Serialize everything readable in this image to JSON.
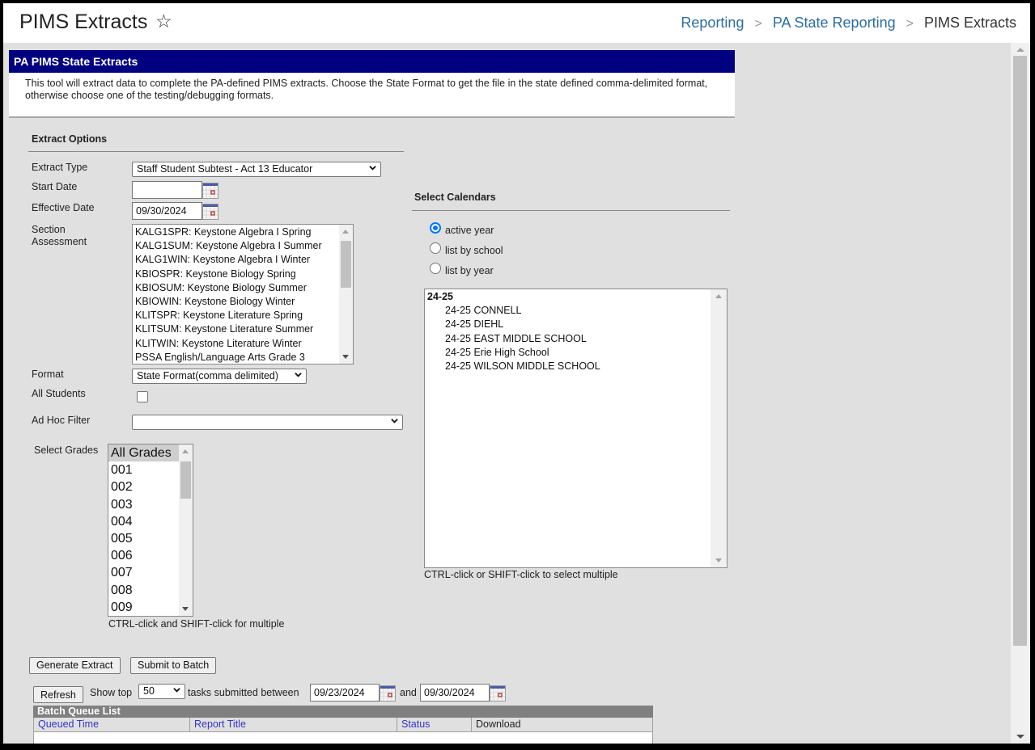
{
  "header": {
    "title": "PIMS Extracts",
    "breadcrumb": [
      "Reporting",
      "PA State Reporting",
      "PIMS Extracts"
    ]
  },
  "panel": {
    "title": "PA PIMS State Extracts",
    "description": "This tool will extract data to complete the PA-defined PIMS extracts. Choose the State Format to get the file in the state defined comma-delimited format, otherwise choose one of the testing/debugging formats."
  },
  "extract_options": {
    "section_title": "Extract Options",
    "extract_type": {
      "label": "Extract Type",
      "value": "Staff Student Subtest - Act 13 Educator"
    },
    "start_date": {
      "label": "Start Date",
      "value": ""
    },
    "effective_date": {
      "label": "Effective Date",
      "value": "09/30/2024"
    },
    "section_assessment": {
      "label_line1": "Section",
      "label_line2": "Assessment",
      "options": [
        "KALG1SPR: Keystone Algebra I Spring",
        "KALG1SUM: Keystone Algebra I Summer",
        "KALG1WIN: Keystone Algebra I Winter",
        "KBIOSPR: Keystone Biology Spring",
        "KBIOSUM: Keystone Biology Summer",
        "KBIOWIN: Keystone Biology Winter",
        "KLITSPR: Keystone Literature Spring",
        "KLITSUM: Keystone Literature Summer",
        "KLITWIN: Keystone Literature Winter",
        "PSSA English/Language Arts Grade 3"
      ]
    },
    "format": {
      "label": "Format",
      "value": "State Format(comma delimited)"
    },
    "all_students": {
      "label": "All Students",
      "checked": false
    },
    "ad_hoc_filter": {
      "label": "Ad Hoc Filter",
      "value": ""
    },
    "grades": {
      "label": "Select Grades",
      "options": [
        "All Grades",
        "001",
        "002",
        "003",
        "004",
        "005",
        "006",
        "007",
        "008",
        "009"
      ],
      "selected": "All Grades",
      "hint": "CTRL-click and SHIFT-click for multiple"
    }
  },
  "calendars": {
    "section_title": "Select Calendars",
    "radios": [
      {
        "label": "active year",
        "checked": true
      },
      {
        "label": "list by school",
        "checked": false
      },
      {
        "label": "list by year",
        "checked": false
      }
    ],
    "group": "24-25",
    "items": [
      "24-25 CONNELL",
      "24-25 DIEHL",
      "24-25 EAST MIDDLE SCHOOL",
      "24-25 Erie High School",
      "24-25 WILSON MIDDLE SCHOOL"
    ],
    "hint": "CTRL-click or SHIFT-click to select multiple"
  },
  "actions": {
    "generate": "Generate Extract",
    "submit": "Submit to Batch"
  },
  "batch": {
    "refresh": "Refresh",
    "show_top_label": "Show top",
    "show_top_value": "50",
    "between_label": "tasks submitted between",
    "from_date": "09/23/2024",
    "and_label": "and",
    "to_date": "09/30/2024",
    "list_title": "Batch Queue List",
    "columns": [
      "Queued Time",
      "Report Title",
      "Status",
      "Download"
    ]
  }
}
